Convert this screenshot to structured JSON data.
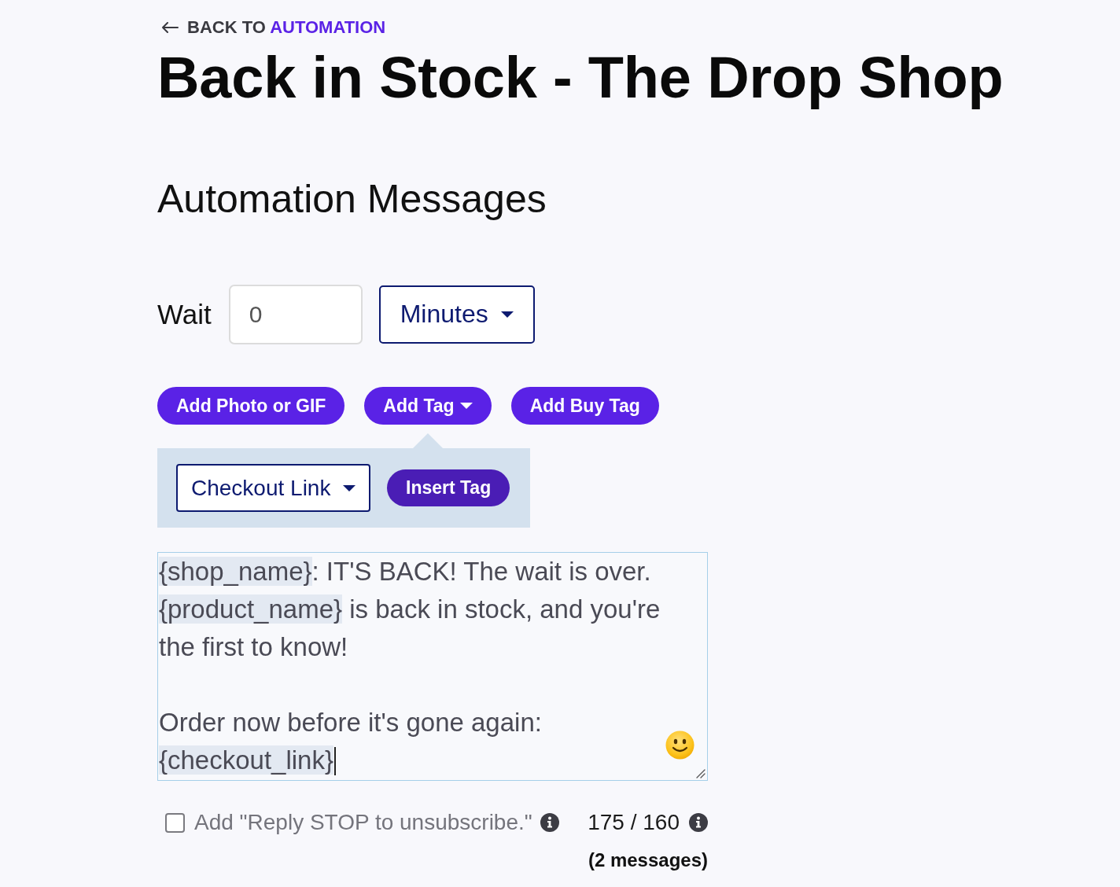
{
  "back_link": {
    "prefix": "BACK TO",
    "label": "AUTOMATION"
  },
  "title": "Back in Stock - The Drop Shop",
  "section_title": "Automation Messages",
  "wait": {
    "label": "Wait",
    "value": "0",
    "unit": "Minutes"
  },
  "toolbar": [
    {
      "label": "Add Photo or GIF",
      "kind": "button"
    },
    {
      "label": "Add Tag",
      "kind": "dropdown"
    },
    {
      "label": "Add Buy Tag",
      "kind": "button"
    }
  ],
  "tag_popover": {
    "tag_select": "Checkout Link",
    "insert_button": "Insert Tag"
  },
  "message": {
    "focused": true,
    "paragraphs": [
      [
        {
          "kind": "tag",
          "text": "{shop_name}"
        },
        {
          "kind": "text",
          "text": ": IT'S BACK! The wait is over. "
        },
        {
          "kind": "tag",
          "text": "{product_name}"
        },
        {
          "kind": "text",
          "text": " is back in stock, and you're the first to know!"
        }
      ],
      [
        {
          "kind": "text",
          "text": "Order now before it's gone again: "
        },
        {
          "kind": "tag",
          "text": "{checkout_link}"
        }
      ]
    ]
  },
  "footer": {
    "unsubscribe": {
      "label": "Add \"Reply STOP to unsubscribe.\"",
      "checked": false
    },
    "counter": "175 / 160",
    "message_count": "(2 messages)"
  }
}
